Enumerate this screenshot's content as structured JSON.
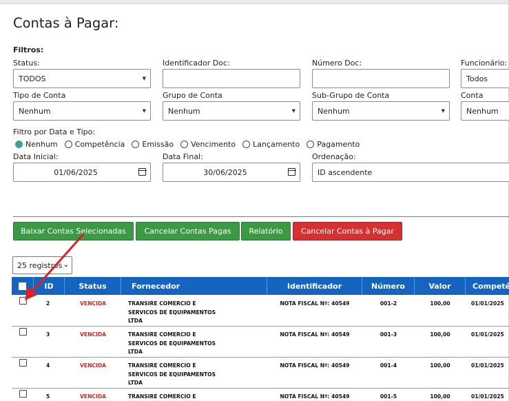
{
  "page": {
    "title": "Contas à Pagar:",
    "filters_title": "Filtros:"
  },
  "filters": {
    "status": {
      "label": "Status:",
      "value": "TODOS"
    },
    "identificador": {
      "label": "Identificador Doc:",
      "value": ""
    },
    "numero": {
      "label": "Número Doc:",
      "value": ""
    },
    "funcionario": {
      "label": "Funcionário:",
      "value": "Todos"
    },
    "tipo_conta": {
      "label": "Tipo de Conta",
      "value": "Nenhum"
    },
    "grupo_conta": {
      "label": "Grupo de Conta",
      "value": "Nenhum"
    },
    "subgrupo_conta": {
      "label": "Sub-Grupo de Conta",
      "value": "Nenhum"
    },
    "conta": {
      "label": "Conta",
      "value": "Nenhum"
    },
    "filtro_data_tipo": {
      "label": "Filtro por Data e Tipo:",
      "options": [
        "Nenhum",
        "Competência",
        "Emissão",
        "Vencimento",
        "Lançamento",
        "Pagamento"
      ],
      "selected": "Nenhum"
    },
    "data_inicial": {
      "label": "Data Inicial:",
      "value": "01/06/2025"
    },
    "data_final": {
      "label": "Data Final:",
      "value": "30/06/2025"
    },
    "ordenacao": {
      "label": "Ordenação:",
      "value": "ID ascendente"
    }
  },
  "actions": {
    "baixar": "Baixar Contas Selecionadas",
    "cancelar_pagas": "Cancelar Contas Pagas",
    "relatorio": "Relatório",
    "cancelar_pagar": "Cancelar Contas à Pagar"
  },
  "page_size": "25 registros",
  "table": {
    "columns": [
      "",
      "ID",
      "Status",
      "Fornecedor",
      "Identificador",
      "Número",
      "Valor",
      "Competência"
    ],
    "rows": [
      {
        "id": "2",
        "status": "VENCIDA",
        "fornecedor": [
          "TRANSIRE COMERCIO E",
          "SERVICOS DE EQUIPAMENTOS",
          "LTDA"
        ],
        "identificador": "NOTA FISCAL Nº: 40549",
        "numero": "001-2",
        "valor": "100,00",
        "competencia": "01/01/2025"
      },
      {
        "id": "3",
        "status": "VENCIDA",
        "fornecedor": [
          "TRANSIRE COMERCIO E",
          "SERVICOS DE EQUIPAMENTOS",
          "LTDA"
        ],
        "identificador": "NOTA FISCAL Nº: 40549",
        "numero": "001-3",
        "valor": "100,00",
        "competencia": "01/01/2025"
      },
      {
        "id": "4",
        "status": "VENCIDA",
        "fornecedor": [
          "TRANSIRE COMERCIO E",
          "SERVICOS DE EQUIPAMENTOS",
          "LTDA"
        ],
        "identificador": "NOTA FISCAL Nº: 40549",
        "numero": "001-4",
        "valor": "100,00",
        "competencia": "01/01/2025"
      },
      {
        "id": "5",
        "status": "VENCIDA",
        "fornecedor": [
          "TRANSIRE COMERCIO E"
        ],
        "identificador": "NOTA FISCAL Nº: 40549",
        "numero": "001-5",
        "valor": "100,00",
        "competencia": "01/01/2025"
      }
    ]
  },
  "colors": {
    "header_blue": "#1565c0",
    "green": "#3c9a44",
    "red": "#d63131",
    "status_red": "#c62828",
    "radio_on": "#3f9f96",
    "annotation_arrow": "#e02020"
  }
}
